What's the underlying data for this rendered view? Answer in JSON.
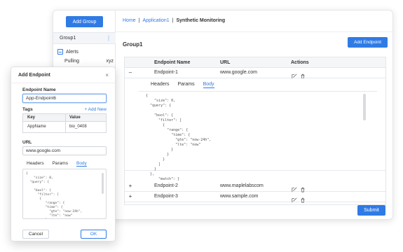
{
  "colors": {
    "accent": "#2f7be5",
    "border": "#e3e6ea"
  },
  "sidebar": {
    "add_group": "Add Group",
    "group": "Group1",
    "kebab": "⋮",
    "alerts": "Alerts",
    "pulling": "Pulling",
    "pulling_suffix": "xyz"
  },
  "breadcrumb": {
    "home": "Home",
    "sep1": "|",
    "app": "Application1",
    "sep2": "|",
    "current": "Synthetic Monitoring"
  },
  "main": {
    "group_title": "Group1",
    "add_endpoint": "Add Endpoint",
    "submit": "Submit",
    "columns": [
      "Endpoint Name",
      "URL",
      "Actions"
    ],
    "rows": [
      {
        "toggle": "–",
        "name": "Endpoint-1",
        "url": "www.google.com"
      },
      {
        "toggle": "+",
        "name": "Endpoint-2",
        "url": "www.maplelabscom"
      },
      {
        "toggle": "+",
        "name": "Endpoint-3",
        "url": "www.sample.com"
      }
    ],
    "tabs": [
      "Headers",
      "Params",
      "Body"
    ],
    "active_tab": "Body",
    "body_code": "{\n    \"size\": 0,\n  \"query\": {\n\n    \"bool\": {\n      \"filter\": [\n        {\n          \"range\": {\n            \"time\": {\n              \"gte\": \"now-24h\",\n              \"lte\": \"now\"\n            }\n          }\n        }\n      ]\n    }\n  },\n      \"match\": }"
  },
  "dialog": {
    "title": "Add Endpoint",
    "close": "×",
    "endpoint_name_label": "Endpoint Name",
    "endpoint_name_value": "App-Endpoint6",
    "tags_label": "Tags",
    "add_new": "+ Add New",
    "tags_columns": [
      "Key",
      "Value"
    ],
    "tags_rows": [
      {
        "key": "AppName",
        "value": "bio_0408"
      }
    ],
    "url_label": "URL",
    "url_value": "www.google.com",
    "tabs": [
      "Headers",
      "Params",
      "Body"
    ],
    "active_tab": "Body",
    "body_code": "{\n    \"size\": 0,\n  \"query\": {\n\n    \"bool\": {\n      \"filter\": [\n       {\n          \"range\": {\n          \"time\": {\n            \"gte\": \"now-24h\",\n            \"lte\": \"now\"\n          }\n        }",
    "cancel": "Cancel",
    "ok": "OK"
  }
}
